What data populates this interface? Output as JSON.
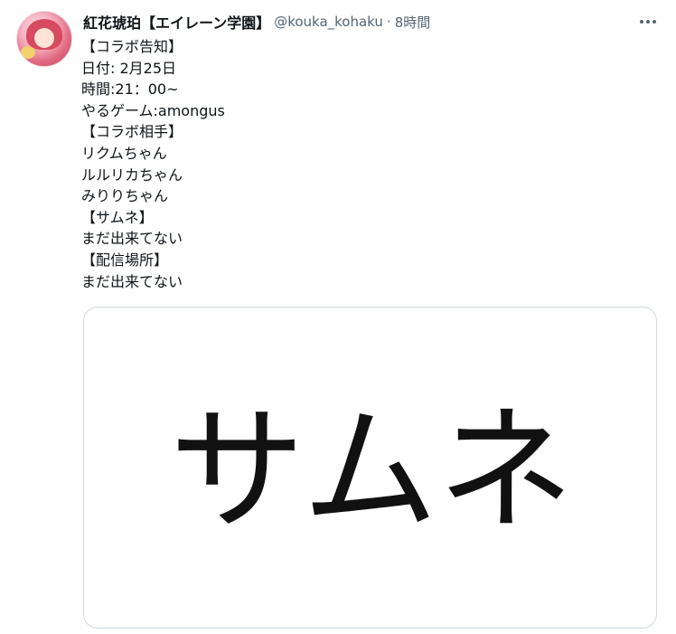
{
  "tweet": {
    "author": {
      "display_name": "紅花琥珀【エイレーン学園】",
      "handle": "@kouka_kohaku",
      "separator": "·",
      "time": "8時間"
    },
    "menu_icon": "more-horizontal-icon",
    "text_lines": [
      "【コラボ告知】",
      "日付: 2月25日",
      "時間:21：00~",
      "やるゲーム:amongus",
      "【コラボ相手】",
      "リクムちゃん",
      "ルルリカちゃん",
      "みりりちゃん",
      "【サムネ】",
      "まだ出来てない",
      "【配信場所】",
      "まだ出来てない"
    ],
    "media": {
      "image_text": "サムネ",
      "background": "#ffffff",
      "ink": "#111111"
    }
  },
  "colors": {
    "text_primary": "#0f1419",
    "text_secondary": "#536471",
    "border": "#cfd9de"
  }
}
